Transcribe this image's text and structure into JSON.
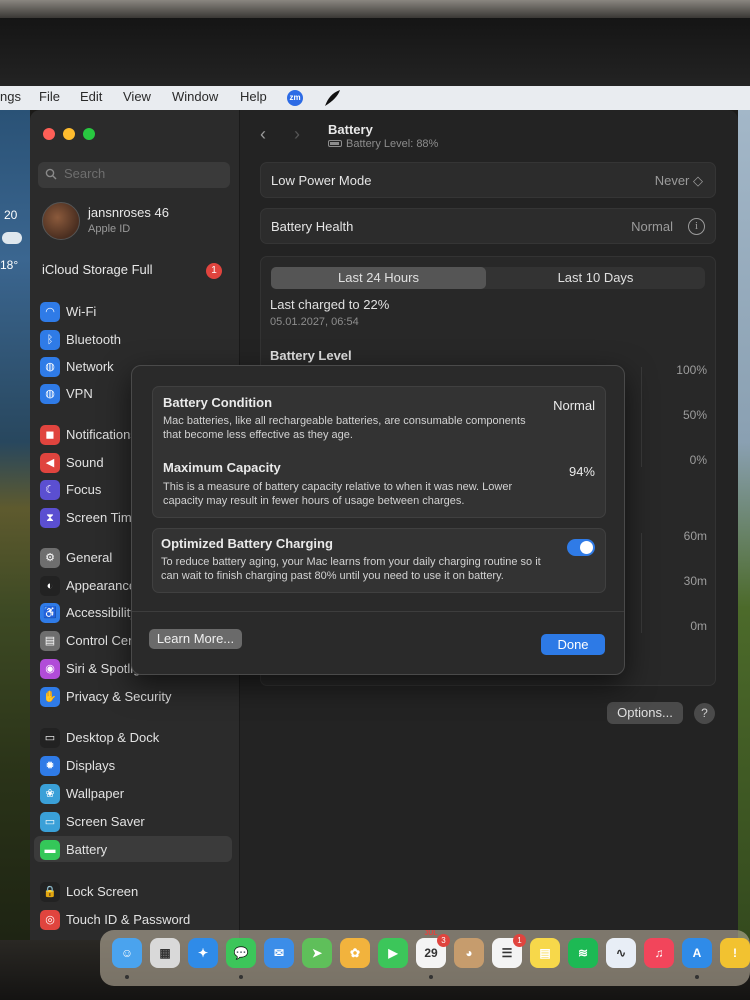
{
  "menubar": {
    "app_fragment": "ngs",
    "items": [
      "File",
      "Edit",
      "View",
      "Window",
      "Help"
    ],
    "extra_icons": [
      "zoom-icon",
      "feather-icon"
    ]
  },
  "desktop_widget": {
    "date": "20",
    "temperature": "18°"
  },
  "sidebar": {
    "search_placeholder": "Search",
    "profile": {
      "name": "jansnroses 46",
      "subtitle": "Apple ID"
    },
    "icloud": {
      "label": "iCloud Storage Full",
      "badge": "1"
    },
    "items": [
      {
        "label": "Wi-Fi",
        "icon": "wifi-icon",
        "color": "#2f7be7",
        "glyph": "◠"
      },
      {
        "label": "Bluetooth",
        "icon": "bluetooth-icon",
        "color": "#2f7be7",
        "glyph": "ᛒ"
      },
      {
        "label": "Network",
        "icon": "network-icon",
        "color": "#2f7be7",
        "glyph": "◍"
      },
      {
        "label": "VPN",
        "icon": "vpn-icon",
        "color": "#2f7be7",
        "glyph": "◍"
      },
      {
        "label": "Notifications",
        "icon": "notifications-icon",
        "color": "#e0443e",
        "glyph": "◼"
      },
      {
        "label": "Sound",
        "icon": "sound-icon",
        "color": "#e0443e",
        "glyph": "◀"
      },
      {
        "label": "Focus",
        "icon": "focus-icon",
        "color": "#5b4fd1",
        "glyph": "☾"
      },
      {
        "label": "Screen Time",
        "icon": "screen-time-icon",
        "color": "#5b4fd1",
        "glyph": "⧗"
      },
      {
        "label": "General",
        "icon": "general-icon",
        "color": "#6e6e6e",
        "glyph": "⚙"
      },
      {
        "label": "Appearance",
        "icon": "appearance-icon",
        "color": "#222",
        "glyph": "◐"
      },
      {
        "label": "Accessibility",
        "icon": "accessibility-icon",
        "color": "#2f7be7",
        "glyph": "♿"
      },
      {
        "label": "Control Centre",
        "icon": "control-centre-icon",
        "color": "#6e6e6e",
        "glyph": "▤"
      },
      {
        "label": "Siri & Spotlight",
        "icon": "siri-icon",
        "color": "#b14cd8",
        "glyph": "◉"
      },
      {
        "label": "Privacy & Security",
        "icon": "privacy-hand-icon",
        "color": "#2f7be7",
        "glyph": "✋"
      },
      {
        "label": "Desktop & Dock",
        "icon": "desktop-dock-icon",
        "color": "#222",
        "glyph": "▭"
      },
      {
        "label": "Displays",
        "icon": "displays-icon",
        "color": "#2f7be7",
        "glyph": "✹"
      },
      {
        "label": "Wallpaper",
        "icon": "wallpaper-icon",
        "color": "#3aa0d8",
        "glyph": "❀"
      },
      {
        "label": "Screen Saver",
        "icon": "screen-saver-icon",
        "color": "#3aa0d8",
        "glyph": "▭"
      },
      {
        "label": "Battery",
        "icon": "battery-icon",
        "color": "#34c759",
        "glyph": "▬"
      },
      {
        "label": "Lock Screen",
        "icon": "lock-icon",
        "color": "#222",
        "glyph": "🔒"
      },
      {
        "label": "Touch ID & Password",
        "icon": "fingerprint-icon",
        "color": "#e0443e",
        "glyph": "◎"
      }
    ]
  },
  "main": {
    "title": "Battery",
    "battery_level_text": "Battery Level: 88%",
    "low_power": {
      "label": "Low Power Mode",
      "value": "Never ◇"
    },
    "health": {
      "label": "Battery Health",
      "value": "Normal"
    },
    "tabs": [
      "Last 24 Hours",
      "Last 10 Days"
    ],
    "last_charged": "Last charged to 22%",
    "last_charged_date": "05.01.2027, 06:54",
    "battery_level_title": "Battery Level",
    "level_ticks": [
      "100%",
      "50%",
      "0%"
    ],
    "usage_ticks": [
      "60m",
      "30m",
      "0m"
    ],
    "options_label": "Options...",
    "help_label": "?"
  },
  "dialog": {
    "condition": {
      "title": "Battery Condition",
      "value": "Normal",
      "desc": "Mac batteries, like all rechargeable batteries, are consumable components that become less effective as they age."
    },
    "capacity": {
      "title": "Maximum Capacity",
      "value": "94%",
      "desc": "This is a measure of battery capacity relative to when it was new. Lower capacity may result in fewer hours of usage between charges."
    },
    "optimized": {
      "title": "Optimized Battery Charging",
      "desc": "To reduce battery aging, your Mac learns from your daily charging routine so it can wait to finish charging past 80% until you need to use it on battery.",
      "enabled": true
    },
    "learn_more": "Learn More...",
    "done": "Done"
  },
  "dock": {
    "apps": [
      {
        "name": "finder-icon",
        "color": "#4aa3ee",
        "glyph": "☺"
      },
      {
        "name": "launchpad-icon",
        "color": "#d9d9d9",
        "glyph": "▦"
      },
      {
        "name": "safari-icon",
        "color": "#2f8be8",
        "glyph": "✦"
      },
      {
        "name": "messages-icon",
        "color": "#3cc65a",
        "glyph": "💬"
      },
      {
        "name": "mail-icon",
        "color": "#3b8de8",
        "glyph": "✉"
      },
      {
        "name": "maps-icon",
        "color": "#5fbf5a",
        "glyph": "➤"
      },
      {
        "name": "photos-icon",
        "color": "#f2b33d",
        "glyph": "✿"
      },
      {
        "name": "facetime-icon",
        "color": "#3cc65a",
        "glyph": "▶"
      },
      {
        "name": "calendar-icon",
        "color": "#f4f4f4",
        "glyph": "29",
        "badge": "3",
        "month": "JUL"
      },
      {
        "name": "contacts-icon",
        "color": "#c69c6d",
        "glyph": "◕"
      },
      {
        "name": "reminders-icon",
        "color": "#f4f4f4",
        "glyph": "☰",
        "badge": "1"
      },
      {
        "name": "notes-icon",
        "color": "#f7d84a",
        "glyph": "▤"
      },
      {
        "name": "spotify-icon",
        "color": "#1db954",
        "glyph": "≋"
      },
      {
        "name": "freeform-icon",
        "color": "#e8eef6",
        "glyph": "∿"
      },
      {
        "name": "music-icon",
        "color": "#f2455b",
        "glyph": "♫"
      },
      {
        "name": "app-store-icon",
        "color": "#2f8be8",
        "glyph": "A"
      },
      {
        "name": "feedback-icon",
        "color": "#f2c230",
        "glyph": "!"
      }
    ]
  }
}
